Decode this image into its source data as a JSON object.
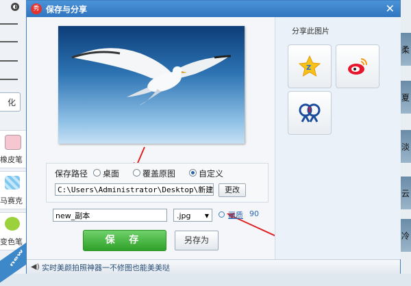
{
  "background_app": {
    "left_tools": [
      {
        "label": "橡皮笔",
        "icon": "eraser-icon"
      },
      {
        "label": "马赛克",
        "icon": "mosaic-icon"
      },
      {
        "label": "变色笔",
        "icon": "color-pen-icon"
      }
    ],
    "left_button_text": "化",
    "new_badge": "new",
    "right_thumbnails": [
      "柔",
      "夏",
      "淡",
      "云",
      "冷"
    ]
  },
  "dialog": {
    "title": "保存与分享",
    "logo_text": "秀",
    "close_glyph": "✕",
    "save_path": {
      "label": "保存路径",
      "options": [
        {
          "label": "桌面",
          "selected": false
        },
        {
          "label": "覆盖原图",
          "selected": false
        },
        {
          "label": "自定义",
          "selected": true
        }
      ],
      "path_value": "C:\\Users\\Administrator\\Desktop\\新建文件夹",
      "change_button": "更改"
    },
    "file_name": "new_副本",
    "format": ".jpg",
    "quality": {
      "label": "画质",
      "value": "90"
    },
    "save_button": "保 存",
    "save_as_button": "另存为",
    "share": {
      "title": "分享此图片",
      "targets": [
        "qzone-icon",
        "weibo-icon",
        "renren-icon"
      ]
    },
    "status_text": "实时美颜拍照神器一不修图也能美美哒"
  },
  "colors": {
    "accent": "#2f75c0",
    "save_green": "#2fa028",
    "annotation_red": "#e02020"
  }
}
